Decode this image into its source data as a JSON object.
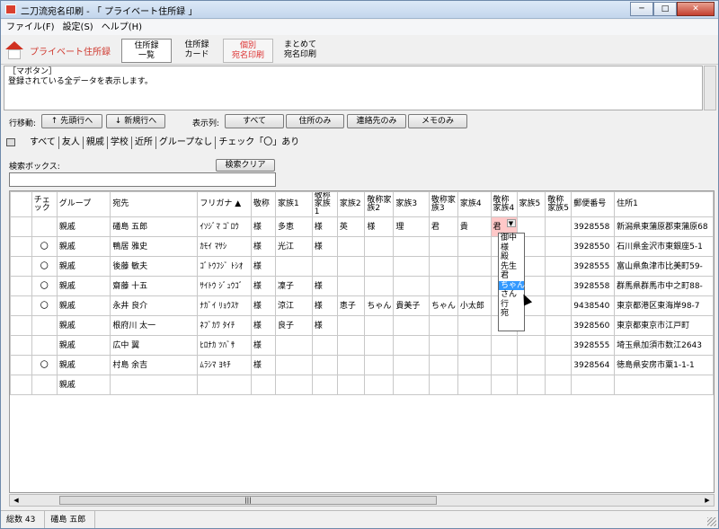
{
  "window": {
    "title": "二刀流宛名印刷  -  「 プライベート住所録 」",
    "btn_min": "─",
    "btn_max": "□",
    "btn_close": "✕"
  },
  "menu": [
    "ファイル(F)",
    "設定(S)",
    "ヘルプ(H)"
  ],
  "toolbar": {
    "brand": "プライベート住所録",
    "buttons": [
      {
        "l1": "住所録",
        "l2": "一覧"
      },
      {
        "l1": "住所録",
        "l2": "カード"
      },
      {
        "l1": "個別",
        "l2": "宛名印刷"
      },
      {
        "l1": "まとめて",
        "l2": "宛名印刷"
      }
    ]
  },
  "description": {
    "line1": "［マボタン］",
    "line2": "登録されている全データを表示します。"
  },
  "nav": {
    "move_label": "行移動:",
    "prev": "↑ 先頭行へ",
    "next": "↓ 新規行へ",
    "show_label": "表示列:",
    "show_all": "すべて",
    "show_addr": "住所のみ",
    "show_contact": "連絡先のみ",
    "show_memo": "メモのみ"
  },
  "filter_tabs": [
    "すべて",
    "友人",
    "親戚",
    "学校",
    "近所",
    "グループなし",
    "チェック「〇」あり"
  ],
  "search": {
    "label": "検索ボックス:",
    "clear": "検索クリア",
    "value": ""
  },
  "grid": {
    "headers": [
      "",
      "チェック",
      "グループ",
      "宛先",
      "フリガナ ▲",
      "敬称",
      "家族1",
      "敬称家族1",
      "家族2",
      "敬称家族2",
      "家族3",
      "敬称家族3",
      "家族4",
      "敬称家族4",
      "家族5",
      "敬称家族5",
      "郵便番号",
      "住所1"
    ],
    "rows": [
      [
        "",
        "",
        "親戚",
        "礒島 五郎",
        "ｲｿｼﾞﾏ ｺﾞﾛｳ",
        "様",
        "多恵",
        "様",
        "英",
        "様",
        "理",
        "君",
        "貴",
        "君",
        "",
        "",
        "3928558",
        "新潟県東蒲原郡東蒲原68"
      ],
      [
        "",
        "〇",
        "親戚",
        "鴨居 雅史",
        "ｶﾓｲ ﾏｻｼ",
        "様",
        "光江",
        "様",
        "",
        "",
        "",
        "",
        "",
        "",
        "",
        "",
        "3928550",
        "石川県金沢市東銀座5-1"
      ],
      [
        "",
        "〇",
        "親戚",
        "後藤 敏夫",
        "ｺﾞﾄｳﾌｼﾞ ﾄｼｵ",
        "様",
        "",
        "",
        "",
        "",
        "",
        "",
        "",
        "",
        "",
        "",
        "3928555",
        "富山県魚津市比美町59-"
      ],
      [
        "",
        "〇",
        "親戚",
        "齋藤 十五",
        "ｻｲﾄｳ ｼﾞｭｳｺﾞ",
        "様",
        "凜子",
        "様",
        "",
        "",
        "",
        "",
        "",
        "",
        "",
        "",
        "3928558",
        "群馬県群馬市中之町88-"
      ],
      [
        "",
        "〇",
        "親戚",
        "永井 良介",
        "ﾅｶﾞｲ ﾘｮｳｽｹ",
        "様",
        "涼江",
        "様",
        "恵子",
        "ちゃん",
        "貴美子",
        "ちゃん",
        "小太郎",
        "",
        "",
        "",
        "9438540",
        "東京都港区東海岸98-7"
      ],
      [
        "",
        "",
        "親戚",
        "根府川 太一",
        "ﾈﾌﾞｶﾜ ﾀｲﾁ",
        "様",
        "良子",
        "様",
        "",
        "",
        "",
        "",
        "",
        "",
        "",
        "",
        "3928560",
        "東京都東京市江戸町"
      ],
      [
        "",
        "",
        "親戚",
        "広中 翼",
        "ﾋﾛﾅｶ ﾂﾊﾞｻ",
        "様",
        "",
        "",
        "",
        "",
        "",
        "",
        "",
        "",
        "",
        "",
        "3928555",
        "埼玉県加須市数江2643"
      ],
      [
        "",
        "〇",
        "親戚",
        "村島 余吉",
        "ﾑﾗｼﾏ ﾖｷﾁ",
        "様",
        "",
        "",
        "",
        "",
        "",
        "",
        "",
        "",
        "",
        "",
        "3928564",
        "徳島県安房市粟1-1-1"
      ],
      [
        "",
        "",
        "親戚",
        "",
        "",
        "",
        "",
        "",
        "",
        "",
        "",
        "",
        "",
        "",
        "",
        "",
        "",
        ""
      ]
    ],
    "dropdown_options": [
      "御中",
      "様",
      "殿",
      "先生",
      "君",
      "ちゃん",
      "さん",
      "行",
      "宛"
    ],
    "dropdown_selected": "ちゃん"
  },
  "status": {
    "count": "総数 43",
    "current": "礒島 五郎"
  }
}
